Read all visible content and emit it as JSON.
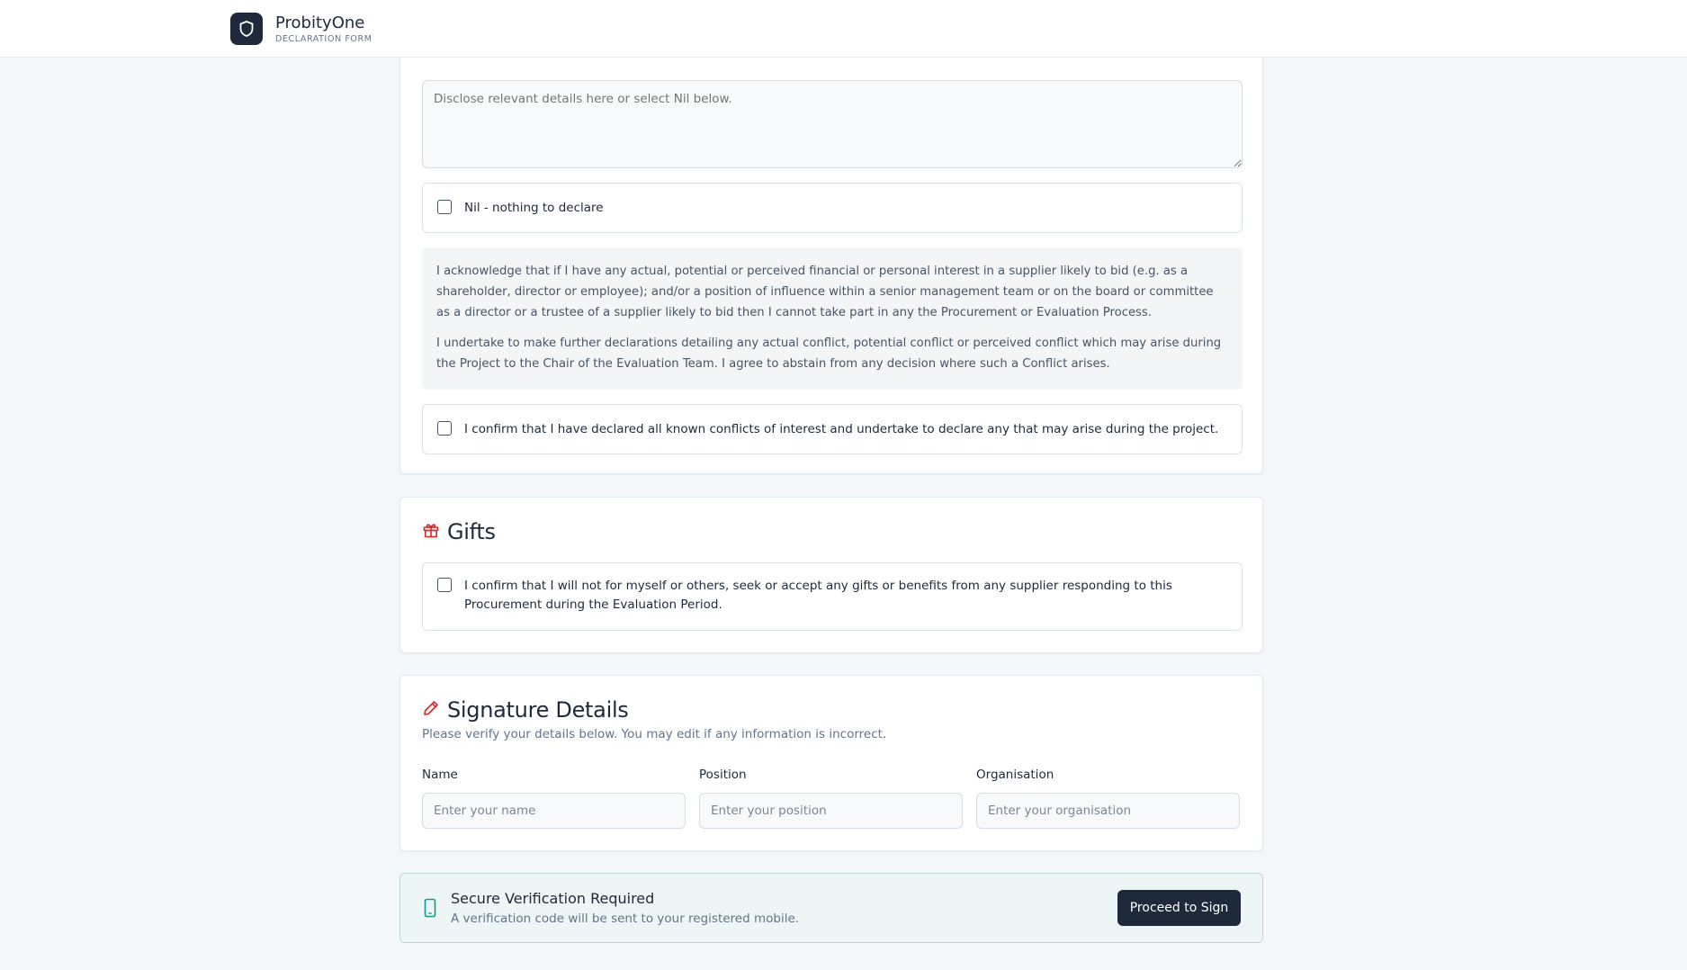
{
  "app": {
    "name": "ProbityOne",
    "subtitle": "DECLARATION FORM"
  },
  "conflicts": {
    "details_placeholder": "Disclose relevant details here or select Nil below.",
    "nil_label": "Nil - nothing to declare",
    "acknowledgement": [
      "I acknowledge that if I have any actual, potential or perceived financial or personal interest in a supplier likely to bid (e.g. as a shareholder, director or employee); and/or a position of influence within a senior management team or on the board or committee as a director or a trustee of a supplier likely to bid then I cannot take part in any the Procurement or Evaluation Process.",
      "I undertake to make further declarations detailing any actual conflict, potential conflict or perceived conflict which may arise during the Project to the Chair of the Evaluation Team. I agree to abstain from any decision where such a Conflict arises."
    ],
    "confirm_label": "I confirm that I have declared all known conflicts of interest and undertake to declare any that may arise during the project."
  },
  "gifts": {
    "title": "Gifts",
    "confirm_label": "I confirm that I will not for myself or others, seek or accept any gifts or benefits from any supplier responding to this Procurement during the Evaluation Period."
  },
  "signature": {
    "title": "Signature Details",
    "description": "Please verify your details below. You may edit if any information is incorrect.",
    "fields": [
      {
        "label": "Name",
        "placeholder": "Enter your name",
        "value": ""
      },
      {
        "label": "Position",
        "placeholder": "Enter your position",
        "value": ""
      },
      {
        "label": "Organisation",
        "placeholder": "Enter your organisation",
        "value": ""
      }
    ]
  },
  "verification": {
    "title": "Secure Verification Required",
    "description": "A verification code will be sent to your registered mobile.",
    "button_label": "Proceed to Sign"
  },
  "colors": {
    "brand_dark": "#1e293b",
    "accent_red": "#dc2626",
    "accent_teal": "#0f9d8a"
  },
  "icons": [
    "shield-icon",
    "gift-icon",
    "pen-icon",
    "smartphone-icon"
  ]
}
